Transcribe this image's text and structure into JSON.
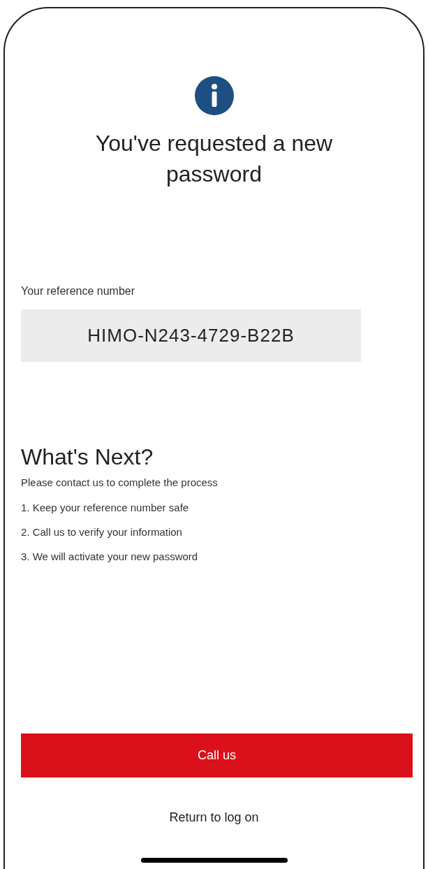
{
  "title": "You've requested a new password",
  "reference": {
    "label": "Your reference number",
    "value": "HIMO-N243-4729-B22B"
  },
  "next": {
    "heading": "What's Next?",
    "intro": "Please contact us to complete the process",
    "steps": [
      "1. Keep your reference number safe",
      "2. Call us to verify your information",
      "3. We will activate your new password"
    ]
  },
  "primary_button": "Call us",
  "secondary_link": "Return to log on"
}
